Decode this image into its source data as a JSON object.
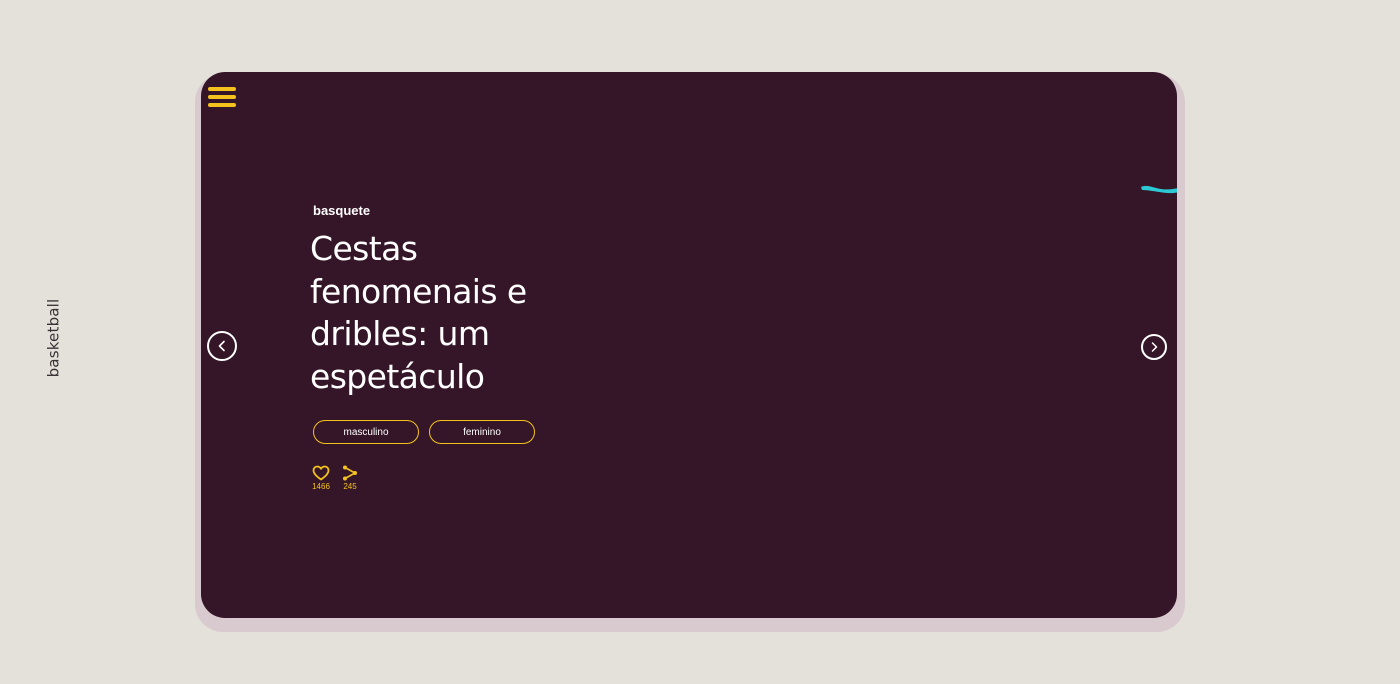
{
  "side_label": "basketball",
  "card": {
    "category": "basquete",
    "headline": "Cestas fenomenais e dribles: um espetáculo",
    "tags": [
      {
        "label": "masculino"
      },
      {
        "label": "feminino"
      }
    ],
    "likes": "1466",
    "shares": "245"
  },
  "icons": {
    "menu": "menu-icon",
    "prev": "chevron-left-icon",
    "next": "chevron-right-icon",
    "like": "heart-icon",
    "share": "share-icon"
  },
  "colors": {
    "background": "#e4e0da",
    "card": "#351628",
    "accent": "#f4c21c",
    "brush": "#2cc9d4"
  }
}
